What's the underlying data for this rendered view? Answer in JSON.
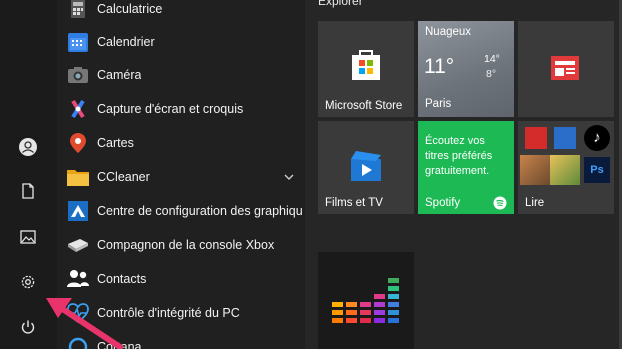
{
  "apps": [
    {
      "label": "Calculatrice",
      "icon": "calculator-icon"
    },
    {
      "label": "Calendrier",
      "icon": "calendar-icon"
    },
    {
      "label": "Caméra",
      "icon": "camera-icon"
    },
    {
      "label": "Capture d'écran et croquis",
      "icon": "snip-sketch-icon"
    },
    {
      "label": "Cartes",
      "icon": "maps-pin-icon"
    },
    {
      "label": "CCleaner",
      "icon": "folder-icon",
      "expandable": true
    },
    {
      "label": "Centre de configuration des graphique...",
      "icon": "graphics-control-icon"
    },
    {
      "label": "Compagnon de la console Xbox",
      "icon": "xbox-console-icon"
    },
    {
      "label": "Contacts",
      "icon": "people-icon"
    },
    {
      "label": "Contrôle d'intégrité du PC",
      "icon": "health-check-icon"
    },
    {
      "label": "Cortana",
      "icon": "cortana-icon"
    }
  ],
  "rail": [
    {
      "name": "user-account",
      "icon": "user-icon"
    },
    {
      "name": "documents",
      "icon": "document-icon"
    },
    {
      "name": "pictures",
      "icon": "picture-icon"
    },
    {
      "name": "settings",
      "icon": "gear-icon"
    },
    {
      "name": "power",
      "icon": "power-icon"
    }
  ],
  "tiles": {
    "group_title": "Explorer",
    "store": {
      "label": "Microsoft Store"
    },
    "weather": {
      "condition": "Nuageux",
      "temp": "11°",
      "high": "14°",
      "low": "8°",
      "city": "Paris"
    },
    "films": {
      "label": "Films et TV"
    },
    "spotify": {
      "text": "Écoutez vos titres préférés gratuitement.",
      "label": "Spotify"
    },
    "lire": {
      "label": "Lire"
    }
  },
  "colors": {
    "accent_pink": "#e8336b",
    "spotify_green": "#1db954",
    "tile_gray": "#3a3a3a",
    "news_red": "#e03a3a"
  }
}
